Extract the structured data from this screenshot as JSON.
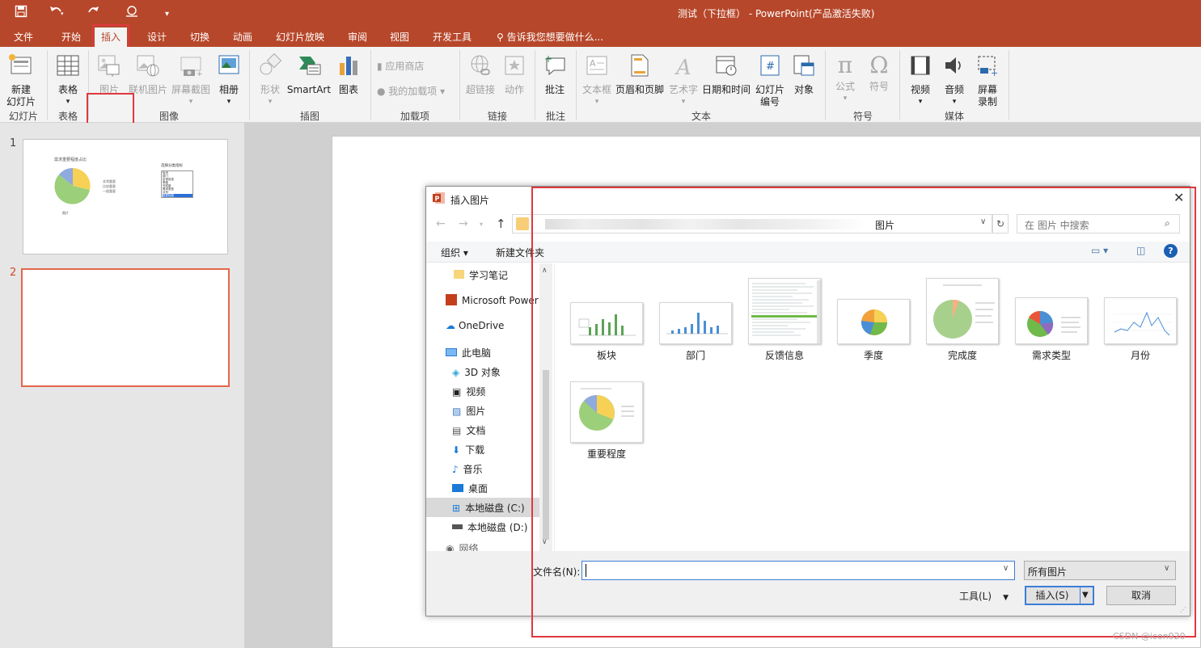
{
  "title": "测试（下拉框） - PowerPoint(产品激活失败)",
  "quick_access": {
    "save": "save-icon",
    "undo": "undo-icon",
    "redo": "redo-icon",
    "touch": "touch-mode-icon",
    "customize": "▾"
  },
  "tabs": [
    "文件",
    "开始",
    "插入",
    "设计",
    "切换",
    "动画",
    "幻灯片放映",
    "审阅",
    "视图",
    "开发工具"
  ],
  "active_tab": "插入",
  "tell_me": "告诉我您想要做什么...",
  "ribbon": {
    "new_slide": "新建\n幻灯片",
    "table": "表格",
    "picture": "图片",
    "online_picture": "联机图片",
    "screenshot": "屏幕截图",
    "album": "相册",
    "shapes": "形状",
    "smartart": "SmartArt",
    "chart": "图表",
    "store": "应用商店",
    "my_addins": "我的加载项",
    "hyperlink": "超链接",
    "action": "动作",
    "comment": "批注",
    "textbox": "文本框",
    "header_footer": "页眉和页脚",
    "wordart": "艺术字",
    "datetime": "日期和时间",
    "slide_number": "幻灯片\n编号",
    "object": "对象",
    "equation": "公式",
    "symbol": "符号",
    "video": "视频",
    "audio": "音频",
    "screen_record": "屏幕\n录制",
    "groups": [
      "幻灯片",
      "表格",
      "图像",
      "插图",
      "加载项",
      "链接",
      "批注",
      "文本",
      "符号",
      "媒体"
    ]
  },
  "slides": [
    {
      "num": "1",
      "title": "需求重要程度占比",
      "legend": [
        "非常重要",
        "比较重要",
        "一般重要"
      ],
      "side_title": "选择分类指标",
      "side_items": [
        "板块",
        "部门",
        "反馈信息",
        "季度",
        "完成度",
        "需求类型",
        "月份",
        "重要程度"
      ],
      "caption": "图片"
    },
    {
      "num": "2"
    }
  ],
  "dialog": {
    "title": "插入图片",
    "location": "图片",
    "search_placeholder": "在 图片 中搜索",
    "organize": "组织 ▾",
    "new_folder": "新建文件夹",
    "nav": [
      "学习笔记",
      "Microsoft Power",
      "OneDrive",
      "此电脑",
      "3D 对象",
      "视频",
      "图片",
      "文档",
      "下载",
      "音乐",
      "桌面",
      "本地磁盘 (C:)",
      "本地磁盘 (D:)",
      "网络"
    ],
    "selected_nav": "本地磁盘 (C:)",
    "files": [
      "板块",
      "部门",
      "反馈信息",
      "季度",
      "完成度",
      "需求类型",
      "月份",
      "重要程度"
    ],
    "filename_label": "文件名(N):",
    "filename_value": "",
    "filter": "所有图片",
    "tools": "工具(L)",
    "insert": "插入(S)",
    "cancel": "取消"
  },
  "watermark": "CSDN @icon920",
  "colors": {
    "brand": "#b7472a",
    "highlight": "#e0383e",
    "selection": "#cce8ff"
  }
}
